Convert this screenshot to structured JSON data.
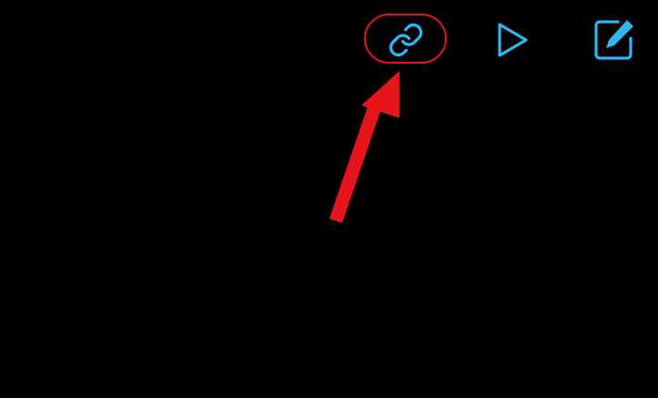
{
  "colors": {
    "background": "#000000",
    "icon": "#2db6f0",
    "annotation": "#e8141c"
  },
  "toolbar": {
    "buttons": [
      {
        "icon": "link-icon"
      },
      {
        "icon": "play-icon"
      },
      {
        "icon": "edit-icon"
      }
    ]
  },
  "annotation": {
    "target": "link-icon",
    "shapes": [
      "highlight-ring",
      "arrow"
    ]
  }
}
